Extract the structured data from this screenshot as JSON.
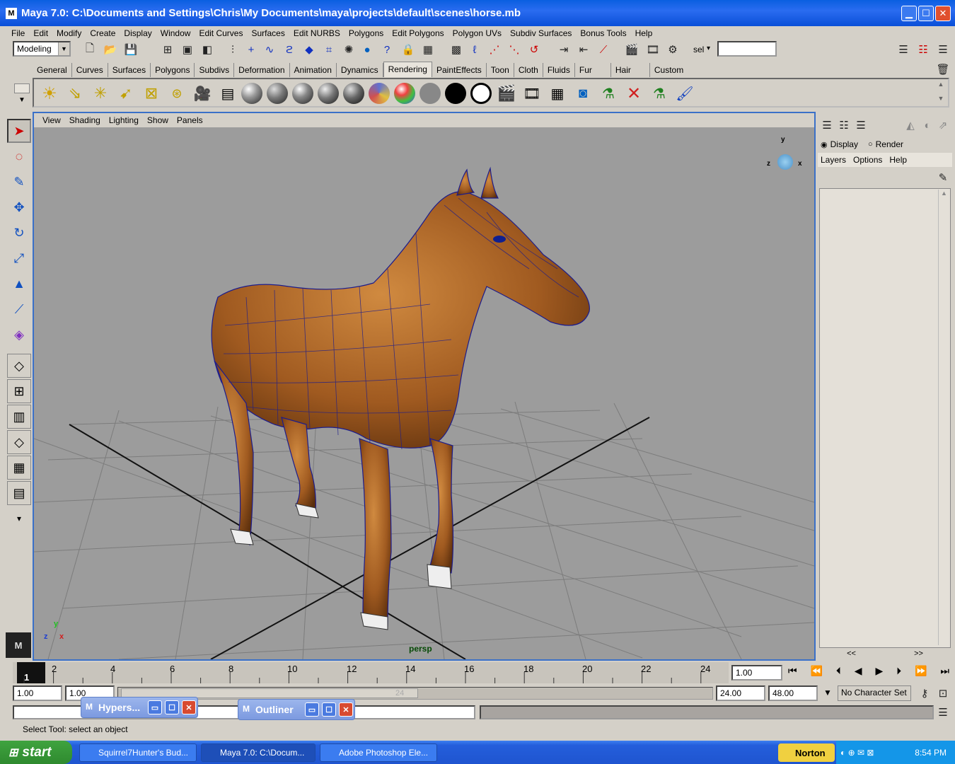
{
  "window": {
    "title": "Maya 7.0: C:\\Documents and Settings\\Chris\\My Documents\\maya\\projects\\default\\scenes\\horse.mb"
  },
  "menubar": [
    "File",
    "Edit",
    "Modify",
    "Create",
    "Display",
    "Window",
    "Edit Curves",
    "Surfaces",
    "Edit NURBS",
    "Polygons",
    "Edit Polygons",
    "Polygon UVs",
    "Subdiv Surfaces",
    "Bonus Tools",
    "Help"
  ],
  "statusline": {
    "mode": "Modeling",
    "sel_label": "sel"
  },
  "shelf_tabs": [
    "General",
    "Curves",
    "Surfaces",
    "Polygons",
    "Subdivs",
    "Deformation",
    "Animation",
    "Dynamics",
    "Rendering",
    "PaintEffects",
    "Toon",
    "Cloth",
    "Fluids",
    "Fur",
    "Hair",
    "Custom"
  ],
  "shelf_active": "Rendering",
  "viewport": {
    "menus": [
      "View",
      "Shading",
      "Lighting",
      "Show",
      "Panels"
    ],
    "camera_label": "persp",
    "axis_y": "y",
    "axis_z": "z",
    "axis_x": "x"
  },
  "right_panel": {
    "display_label": "Display",
    "render_label": "Render",
    "menus": [
      "Layers",
      "Options",
      "Help"
    ],
    "scroll_left": "<<",
    "scroll_right": ">>"
  },
  "timeline": {
    "ticks": [
      "2",
      "4",
      "6",
      "8",
      "10",
      "12",
      "14",
      "16",
      "18",
      "20",
      "22",
      "24"
    ],
    "current_frame": "1",
    "current_field": "1.00"
  },
  "range": {
    "start": "1.00",
    "playback_start": "1.00",
    "range_end_marker": "24",
    "playback_end": "24.00",
    "end": "48.00",
    "character_set": "No Character Set"
  },
  "floating_windows": [
    {
      "title": "Hypers..."
    },
    {
      "title": "Outliner"
    }
  ],
  "help_line": "Select Tool: select an object",
  "taskbar": {
    "start": "start",
    "tasks": [
      "Squirrel7Hunter's Bud...",
      "Maya 7.0: C:\\Docum...",
      "Adobe Photoshop Ele..."
    ],
    "norton": "Norton",
    "clock": "8:54 PM"
  }
}
